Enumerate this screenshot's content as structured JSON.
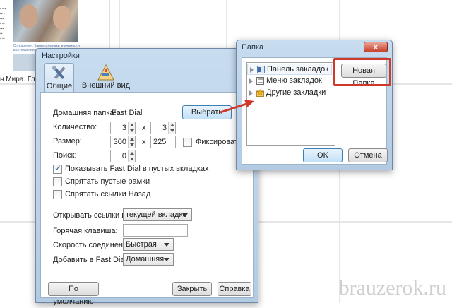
{
  "background": {
    "thumbnail_caption": "н Мира. Глав",
    "thumbnail_lines": [
      "Отношения: Какие признаки значимости",
      "в отношениях не заметить"
    ],
    "watermark": "brauzerok.ru"
  },
  "settings_dialog": {
    "title": "Настройки",
    "tabs": [
      {
        "label": "Общие",
        "icon": "wrench-screwdriver-icon"
      },
      {
        "label": "Внешний вид",
        "icon": "paint-palette-icon"
      }
    ],
    "home_folder_label": "Домашняя папка:",
    "home_folder_value": "Fast Dial",
    "choose_button": "Выбрать",
    "count_label": "Количество:",
    "count_cols": "3",
    "count_rows": "3",
    "size_label": "Размер:",
    "size_width": "300",
    "size_height": "225",
    "times_sign": "x",
    "fix_label": "Фиксировать",
    "search_label": "Поиск:",
    "search_value": "0",
    "checkboxes": [
      {
        "label": "Показывать Fast Dial в пустых вкладках",
        "checked": true
      },
      {
        "label": "Спрятать пустые рамки",
        "checked": false
      },
      {
        "label": "Спрятать ссылки Назад",
        "checked": false
      }
    ],
    "open_links_label": "Открывать ссылки в:",
    "open_links_value": "текущей вкладке",
    "hotkey_label": "Горячая клавиша:",
    "hotkey_value": "",
    "speed_label": "Скорость соединения:",
    "speed_value": "Быстрая",
    "add_to_label": "Добавить в Fast Dial:",
    "add_to_value": "Домашняя",
    "default_button": "По умолчанию",
    "close_button": "Закрыть",
    "help_button": "Справка"
  },
  "folder_dialog": {
    "title": "Папка",
    "close_glyph": "x",
    "tree_items": [
      {
        "label": "Панель закладок",
        "icon": "bookmark-bar-icon"
      },
      {
        "label": "Меню закладок",
        "icon": "bookmark-menu-icon"
      },
      {
        "label": "Другие закладки",
        "icon": "star-folder-icon"
      }
    ],
    "new_folder_button": "Новая Папка",
    "ok_button": "OK",
    "cancel_button": "Отмена"
  },
  "colors": {
    "annotation_red": "#d0392a",
    "window_frame": "#b2cbe3"
  }
}
